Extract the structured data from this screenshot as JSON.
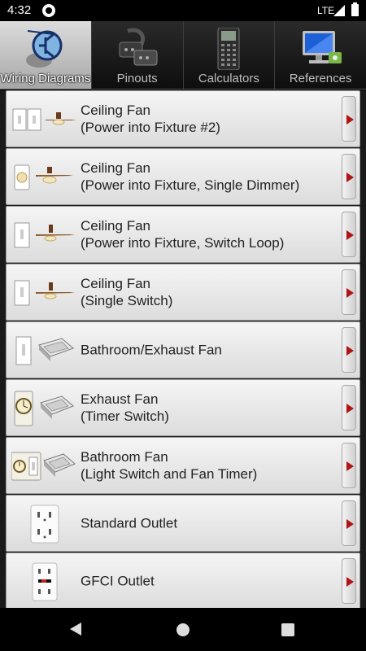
{
  "status_bar": {
    "time": "4:32",
    "network": "LTE",
    "app_icon": "app-notification-icon",
    "signal_icon": "signal-icon",
    "battery_icon": "battery-icon"
  },
  "tabs": [
    {
      "label": "Wiring Diagrams",
      "icon": "wiring-diagrams-icon",
      "active": true
    },
    {
      "label": "Pinouts",
      "icon": "pinouts-icon",
      "active": false
    },
    {
      "label": "Calculators",
      "icon": "calculators-icon",
      "active": false
    },
    {
      "label": "References",
      "icon": "references-icon",
      "active": false
    }
  ],
  "items": [
    {
      "line1": "Ceiling Fan",
      "line2": "(Power into Fixture #2)",
      "thumb": "two-switches-fan"
    },
    {
      "line1": "Ceiling Fan",
      "line2": "(Power into Fixture, Single Dimmer)",
      "thumb": "dimmer-fan"
    },
    {
      "line1": "Ceiling Fan",
      "line2": "(Power into Fixture, Switch Loop)",
      "thumb": "switch-fan"
    },
    {
      "line1": "Ceiling Fan",
      "line2": "(Single Switch)",
      "thumb": "switch-fan"
    },
    {
      "line1": "Bathroom/Exhaust Fan",
      "line2": "",
      "thumb": "switch-exhaust"
    },
    {
      "line1": "Exhaust Fan",
      "line2": "(Timer Switch)",
      "thumb": "timer-exhaust"
    },
    {
      "line1": "Bathroom Fan",
      "line2": "(Light Switch and Fan Timer)",
      "thumb": "timer-switch-exhaust"
    },
    {
      "line1": "Standard Outlet",
      "line2": "",
      "thumb": "outlet"
    },
    {
      "line1": "GFCI Outlet",
      "line2": "",
      "thumb": "gfci"
    }
  ],
  "colors": {
    "accent_arrow": "#b01515",
    "active_tab": "#c8c8c8",
    "row_bg": "#e8e8e8"
  },
  "nav": {
    "back_icon": "back-icon",
    "home_icon": "home-icon",
    "recents_icon": "recents-icon"
  }
}
